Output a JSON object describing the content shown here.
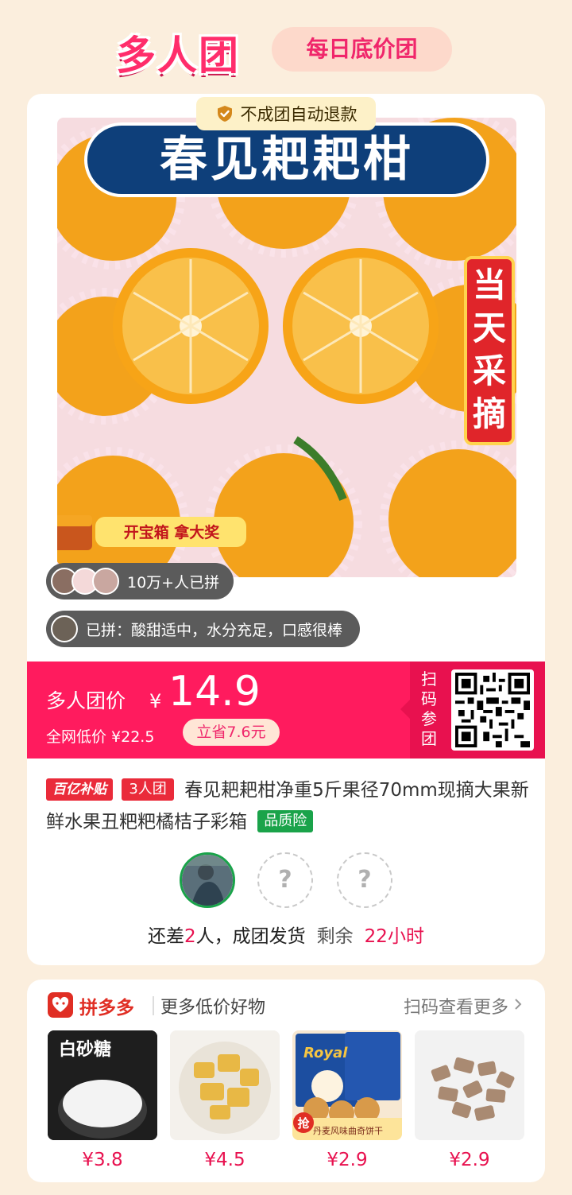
{
  "header": {
    "logo": "多人团",
    "tab": "每日底价团"
  },
  "product": {
    "refund_notice": "不成团自动退款",
    "image_banner": "春见耙耙柑",
    "image_side_tag": "当天采摘",
    "image_promo": "开宝箱 拿大奖",
    "joined_count": "10万+人已拼",
    "review": "已拼：酸甜适中，水分充足，口感很棒",
    "subsidy_badge": "百亿补贴",
    "group_badge": "3人团",
    "title": "春见耙耙柑净重5斤果径70mm现摘大果新鲜水果丑粑粑橘桔子彩箱",
    "quality_badge": "品质险"
  },
  "price": {
    "label": "多人团价",
    "symbol": "¥",
    "value": "14.9",
    "market_label": "全网低价 ¥22.5",
    "save": "立省7.6元",
    "qr_label": "扫码参团"
  },
  "group_status": {
    "prefix": "还差",
    "remaining_people": "2",
    "suffix": "人，成团发货",
    "time_label": "剩余",
    "time_left": "22小时",
    "empty_slot": "?"
  },
  "recommend": {
    "brand": "拼多多",
    "title": "更多低价好物",
    "scan_more": "扫码查看更多",
    "products": [
      {
        "price": "¥3.8",
        "label": "白砂糖"
      },
      {
        "price": "¥4.5"
      },
      {
        "price": "¥2.9",
        "label": "Royal",
        "tag": "抢",
        "caption": "丹麦风味曲奇饼干"
      },
      {
        "price": "¥2.9"
      }
    ]
  },
  "colors": {
    "accent": "#ff1b5e",
    "brand_red": "#e02e24",
    "quality_green": "#1aa34a"
  }
}
